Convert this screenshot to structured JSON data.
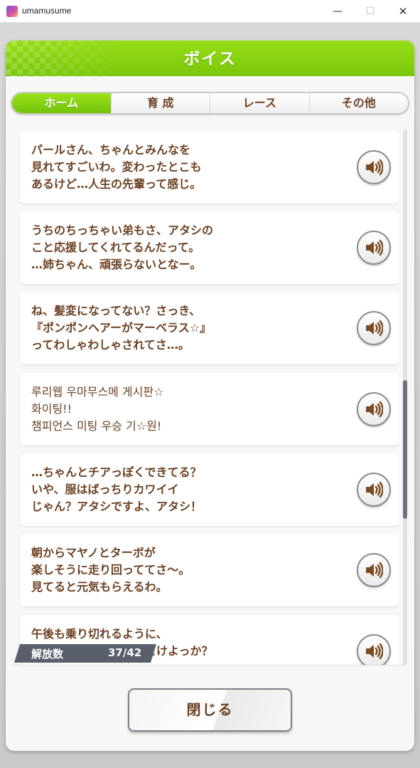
{
  "window": {
    "title": "umamusume",
    "minimize": "—",
    "maximize": "☐",
    "close": "✕"
  },
  "dialog": {
    "title": "ボイス",
    "tabs": [
      {
        "label": "ホーム",
        "active": true
      },
      {
        "label": "育 成",
        "active": false
      },
      {
        "label": "レース",
        "active": false
      },
      {
        "label": "その他",
        "active": false
      }
    ],
    "voices": [
      {
        "lines": [
          "パールさん、ちゃんとみんなを",
          "見れてすごいわ。変わったとこも",
          "あるけど…人生の先輩って感じ。"
        ]
      },
      {
        "lines": [
          "うちのちっちゃい弟もさ、アタシの",
          "こと応援してくれてるんだって。",
          "…姉ちゃん、頑張らないとなー。"
        ]
      },
      {
        "lines": [
          "ね、髪変になってない？さっき、",
          "『ポンポンヘアーがマーベラス☆』",
          "ってわしゃわしゃされてさ…。"
        ]
      },
      {
        "lines": [
          "루리웹 우마무스메 게시판☆",
          "화이팅!!",
          "챔피언스 미팅 우승 기☆원!"
        ]
      },
      {
        "lines": [
          "…ちゃんとチアっぽくできてる？",
          "いや、服はばっちりカワイイ",
          "じゃん？アタシですよ、アタシ！"
        ]
      },
      {
        "lines": [
          "朝からマヤノとターボが",
          "楽しそうに走り回っててさ～。",
          "見てると元気もらえるわ。"
        ]
      },
      {
        "lines": [
          "午後も乗り切れるように、",
          "ちゃんとやる気を高めとけよっか？"
        ]
      }
    ],
    "unlock": {
      "label": "解放数",
      "count": "37/42"
    },
    "close_label": "閉じる"
  }
}
